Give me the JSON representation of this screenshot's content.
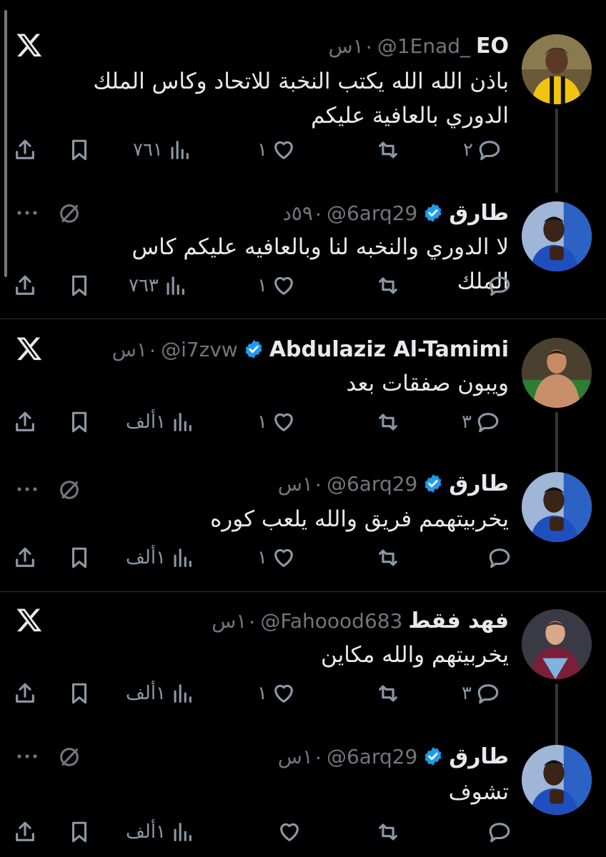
{
  "threads": [
    {
      "original": {
        "name": "EO",
        "handle": "@1Enad_",
        "time": "١٠س",
        "text_lines": [
          "باذن الله الله يكتب النخبة للاتحاد وكاس الملك",
          "الدوري بالعافية عليكم"
        ],
        "replies": "٢",
        "likes": "١",
        "views": "٧٦١"
      },
      "reply": {
        "name": "طارق",
        "handle": "@6arq29",
        "time": "٥٩٠د",
        "text_lines": [
          "لا الدوري والنخبه لنا وبالعافيه عليكم كاس الملك"
        ],
        "replies": "",
        "likes": "١",
        "views": "٧٦٣"
      }
    },
    {
      "original": {
        "name": "Abdulaziz Al-Tamimi",
        "handle": "@i7zvw",
        "time": "١٠س",
        "text_lines": [
          "ويبون صفقات بعد"
        ],
        "replies": "٣",
        "likes": "١",
        "views": "١ألف"
      },
      "reply": {
        "name": "طارق",
        "handle": "@6arq29",
        "time": "١٠س",
        "text_lines": [
          "يخربيتهمم فريق والله يلعب كوره"
        ],
        "replies": "",
        "likes": "١",
        "views": "١ألف"
      }
    },
    {
      "original": {
        "name": "فهد فقط",
        "handle": "@Fahoood683",
        "time": "١٠س",
        "text_lines": [
          "يخربيتهم والله مكاين"
        ],
        "replies": "٣",
        "likes": "١",
        "views": "١ألف"
      },
      "reply": {
        "name": "طارق",
        "handle": "@6arq29",
        "time": "١٠س",
        "text_lines": [
          "تشوف"
        ],
        "replies": "",
        "likes": "",
        "views": "١ألف"
      }
    }
  ],
  "icons": {
    "reply": "reply-icon",
    "retweet": "retweet-icon",
    "like": "heart-icon",
    "views": "views-icon",
    "bookmark": "bookmark-icon",
    "share": "share-icon",
    "x_logo": "x-logo-icon",
    "grok": "grok-icon",
    "more": "more-icon",
    "verified": "verified-badge-icon"
  },
  "colors": {
    "background": "#000000",
    "text": "#e7e9ea",
    "muted": "#71767b",
    "verified": "#1d9bf0",
    "divider": "#2f3336"
  }
}
